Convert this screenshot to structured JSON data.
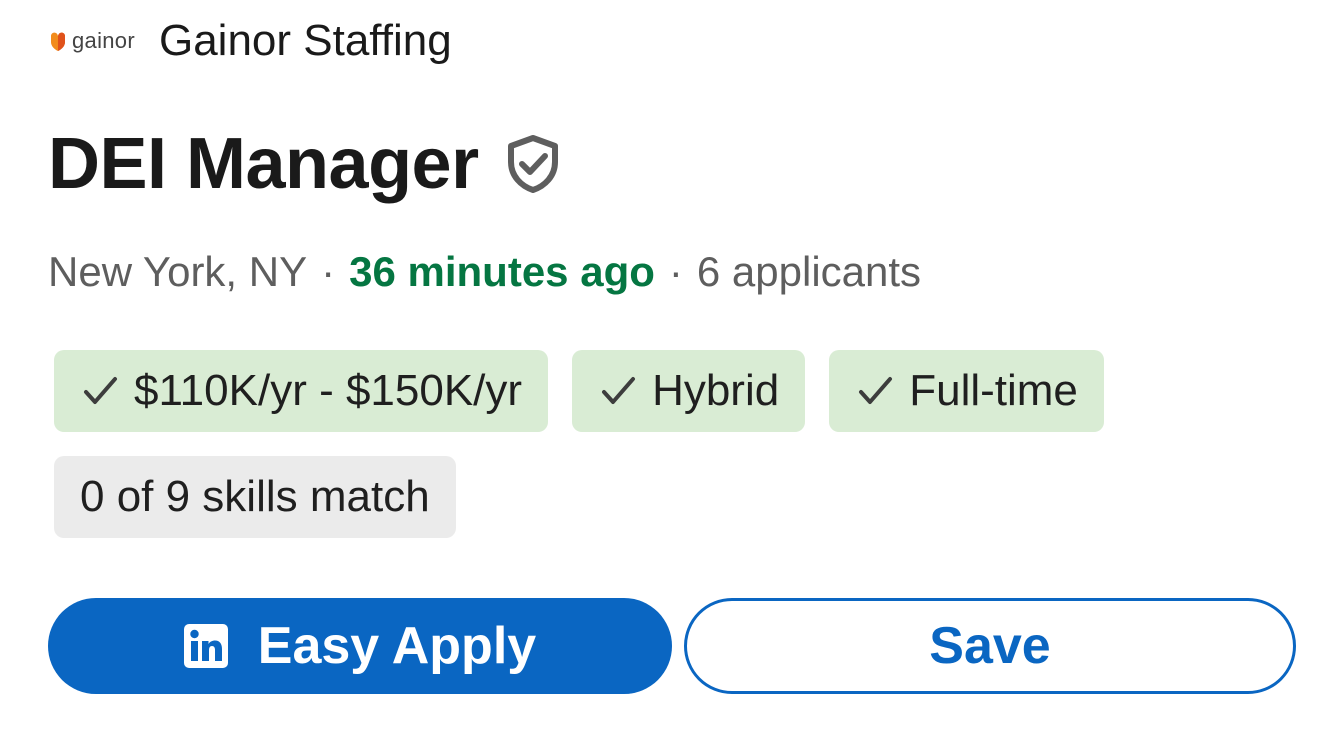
{
  "company": {
    "logo_text": "gainor",
    "name": "Gainor Staffing"
  },
  "job": {
    "title": "DEI Manager",
    "verified_icon": "shield-check-icon"
  },
  "meta": {
    "location": "New York, NY",
    "separator": "·",
    "posted": "36 minutes ago",
    "applicants": "6 applicants"
  },
  "chips": [
    {
      "label": "$110K/yr - $150K/yr",
      "icon": "check-icon"
    },
    {
      "label": "Hybrid",
      "icon": "check-icon"
    },
    {
      "label": "Full-time",
      "icon": "check-icon"
    }
  ],
  "skills": {
    "label": "0 of 9 skills match"
  },
  "actions": {
    "apply_label": "Easy Apply",
    "apply_icon": "linkedin-icon",
    "save_label": "Save"
  },
  "colors": {
    "primary": "#0a66c2",
    "posted_green": "#057642",
    "chip_green": "#d9ecd4",
    "chip_gray": "#ebebeb",
    "logo_orange": "#f28c1c"
  }
}
